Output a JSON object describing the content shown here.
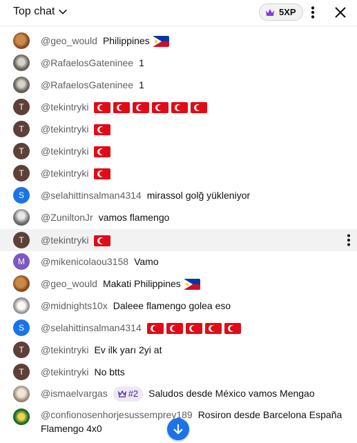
{
  "header": {
    "title": "Top chat",
    "xp_label": "5XP",
    "icons": {
      "chevron": "chevron-down-icon",
      "crown": "crown-icon",
      "more": "more-vert-icon",
      "close": "close-icon"
    }
  },
  "messages": [
    {
      "author": "@geo_would",
      "text": "Philippines",
      "flags": [
        "ph"
      ],
      "avatar": "photo"
    },
    {
      "author": "@RafaelosGateninee",
      "text": "1",
      "flags": [],
      "avatar": "photo"
    },
    {
      "author": "@RafaelosGateninee",
      "text": "1",
      "flags": [],
      "avatar": "photo"
    },
    {
      "author": "@tekintryki",
      "text": "",
      "flags": [
        "tr",
        "tr",
        "tr",
        "tr",
        "tr",
        "tr"
      ],
      "avatar": "T"
    },
    {
      "author": "@tekintryki",
      "text": "",
      "flags": [
        "tr"
      ],
      "avatar": "T"
    },
    {
      "author": "@tekintryki",
      "text": "",
      "flags": [
        "tr"
      ],
      "avatar": "T"
    },
    {
      "author": "@tekintryki",
      "text": "",
      "flags": [
        "tr"
      ],
      "avatar": "T"
    },
    {
      "author": "@selahittinsalman4314",
      "text": "mirassol golğ yükleniyor",
      "flags": [],
      "avatar": "S"
    },
    {
      "author": "@ZuniltonJr",
      "text": "vamos flamengo",
      "flags": [],
      "avatar": "photo"
    },
    {
      "author": "@tekintryki",
      "text": "",
      "flags": [
        "tr"
      ],
      "avatar": "T",
      "highlighted": true
    },
    {
      "author": "@mikenicolaou3158",
      "text": "Vamo",
      "flags": [],
      "avatar": "M"
    },
    {
      "author": "@geo_would",
      "text": "Makati Philippines",
      "flags": [
        "ph"
      ],
      "avatar": "photo"
    },
    {
      "author": "@midnights10x",
      "text": "Daleee flamengo golea eso",
      "flags": [],
      "avatar": "photo"
    },
    {
      "author": "@selahittinsalman4314",
      "text": "",
      "flags": [
        "tr",
        "tr",
        "tr",
        "tr",
        "tr"
      ],
      "avatar": "S"
    },
    {
      "author": "@tekintryki",
      "text": "Ev ilk yarı 2yi at",
      "flags": [],
      "avatar": "T"
    },
    {
      "author": "@tekintryki",
      "text": "No btts",
      "flags": [],
      "avatar": "T"
    },
    {
      "author": "@ismaelvargas",
      "badge": "#2",
      "text": "Saludos desde México vamos Mengao",
      "flags": [],
      "avatar": "photo"
    },
    {
      "author": "@confionosenhorjesussemprey189",
      "text": "Rosiron desde Barcelona España Flamengo 4x0",
      "flags": [],
      "avatar": "photo"
    }
  ],
  "colors": {
    "author": "#606060",
    "text": "#0f0f0f",
    "highlight_row": "#f2f2f2",
    "scroll_button": "#1a73e8",
    "turkey_flag": "#e30a17"
  }
}
